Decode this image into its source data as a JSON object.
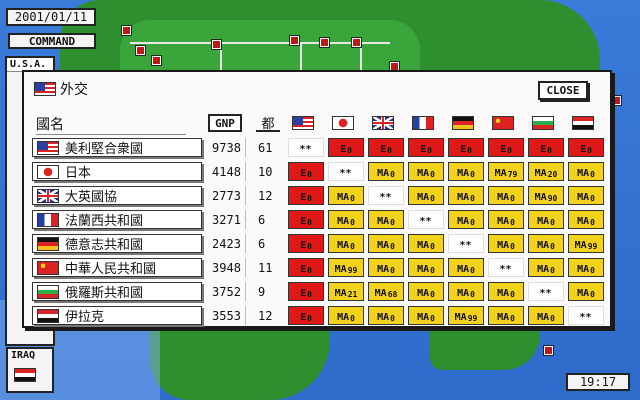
{
  "status": {
    "date": "2001/01/11",
    "command_label": "COMMAND",
    "time": "19:17"
  },
  "side_cards": {
    "top_label": "U.S.A.",
    "bottom_label": "IRAQ"
  },
  "dialog": {
    "title": "外交",
    "close_label": "CLOSE",
    "col_name": "國名",
    "col_gnp": "GNP",
    "col_city": "都",
    "flag_columns": [
      "us",
      "jp",
      "uk",
      "fr",
      "de",
      "cn",
      "ru",
      "iq"
    ]
  },
  "colors": {
    "hostile": "#e01818",
    "neutral": "#f2d21a"
  },
  "rows": [
    {
      "flag": "us",
      "name": "美利堅合衆國",
      "gnp": "9738",
      "city": "61",
      "cells": [
        [
          "self",
          "**",
          ""
        ],
        [
          "red",
          "E",
          "0"
        ],
        [
          "red",
          "E",
          "0"
        ],
        [
          "red",
          "E",
          "0"
        ],
        [
          "red",
          "E",
          "0"
        ],
        [
          "red",
          "E",
          "0"
        ],
        [
          "red",
          "E",
          "0"
        ],
        [
          "red",
          "E",
          "0"
        ]
      ]
    },
    {
      "flag": "jp",
      "name": "日本",
      "gnp": "4148",
      "city": "10",
      "cells": [
        [
          "red",
          "E",
          "0"
        ],
        [
          "self",
          "**",
          ""
        ],
        [
          "yellow",
          "MA",
          "0"
        ],
        [
          "yellow",
          "MA",
          "0"
        ],
        [
          "yellow",
          "MA",
          "0"
        ],
        [
          "yellow",
          "MA",
          "79"
        ],
        [
          "yellow",
          "MA",
          "20"
        ],
        [
          "yellow",
          "MA",
          "0"
        ]
      ]
    },
    {
      "flag": "uk",
      "name": "大英國協",
      "gnp": "2773",
      "city": "12",
      "cells": [
        [
          "red",
          "E",
          "0"
        ],
        [
          "yellow",
          "MA",
          "0"
        ],
        [
          "self",
          "**",
          ""
        ],
        [
          "yellow",
          "MA",
          "0"
        ],
        [
          "yellow",
          "MA",
          "0"
        ],
        [
          "yellow",
          "MA",
          "0"
        ],
        [
          "yellow",
          "MA",
          "90"
        ],
        [
          "yellow",
          "MA",
          "0"
        ]
      ]
    },
    {
      "flag": "fr",
      "name": "法蘭西共和國",
      "gnp": "3271",
      "city": "6",
      "cells": [
        [
          "red",
          "E",
          "0"
        ],
        [
          "yellow",
          "MA",
          "0"
        ],
        [
          "yellow",
          "MA",
          "0"
        ],
        [
          "self",
          "**",
          ""
        ],
        [
          "yellow",
          "MA",
          "0"
        ],
        [
          "yellow",
          "MA",
          "0"
        ],
        [
          "yellow",
          "MA",
          "0"
        ],
        [
          "yellow",
          "MA",
          "0"
        ]
      ]
    },
    {
      "flag": "de",
      "name": "德意志共和國",
      "gnp": "2423",
      "city": "6",
      "cells": [
        [
          "red",
          "E",
          "0"
        ],
        [
          "yellow",
          "MA",
          "0"
        ],
        [
          "yellow",
          "MA",
          "0"
        ],
        [
          "yellow",
          "MA",
          "0"
        ],
        [
          "self",
          "**",
          ""
        ],
        [
          "yellow",
          "MA",
          "0"
        ],
        [
          "yellow",
          "MA",
          "0"
        ],
        [
          "yellow",
          "MA",
          "99"
        ]
      ]
    },
    {
      "flag": "cn",
      "name": "中華人民共和國",
      "gnp": "3948",
      "city": "11",
      "cells": [
        [
          "red",
          "E",
          "0"
        ],
        [
          "yellow",
          "MA",
          "99"
        ],
        [
          "yellow",
          "MA",
          "0"
        ],
        [
          "yellow",
          "MA",
          "0"
        ],
        [
          "yellow",
          "MA",
          "0"
        ],
        [
          "self",
          "**",
          ""
        ],
        [
          "yellow",
          "MA",
          "0"
        ],
        [
          "yellow",
          "MA",
          "0"
        ]
      ]
    },
    {
      "flag": "ru",
      "name": "俄羅斯共和國",
      "gnp": "3752",
      "city": "9",
      "cells": [
        [
          "red",
          "E",
          "0"
        ],
        [
          "yellow",
          "MA",
          "21"
        ],
        [
          "yellow",
          "MA",
          "68"
        ],
        [
          "yellow",
          "MA",
          "0"
        ],
        [
          "yellow",
          "MA",
          "0"
        ],
        [
          "yellow",
          "MA",
          "0"
        ],
        [
          "self",
          "**",
          ""
        ],
        [
          "yellow",
          "MA",
          "0"
        ]
      ]
    },
    {
      "flag": "iq",
      "name": "伊拉克",
      "gnp": "3553",
      "city": "12",
      "cells": [
        [
          "red",
          "E",
          "0"
        ],
        [
          "yellow",
          "MA",
          "0"
        ],
        [
          "yellow",
          "MA",
          "0"
        ],
        [
          "yellow",
          "MA",
          "0"
        ],
        [
          "yellow",
          "MA",
          "99"
        ],
        [
          "yellow",
          "MA",
          "0"
        ],
        [
          "yellow",
          "MA",
          "0"
        ],
        [
          "self",
          "**",
          ""
        ]
      ]
    }
  ]
}
